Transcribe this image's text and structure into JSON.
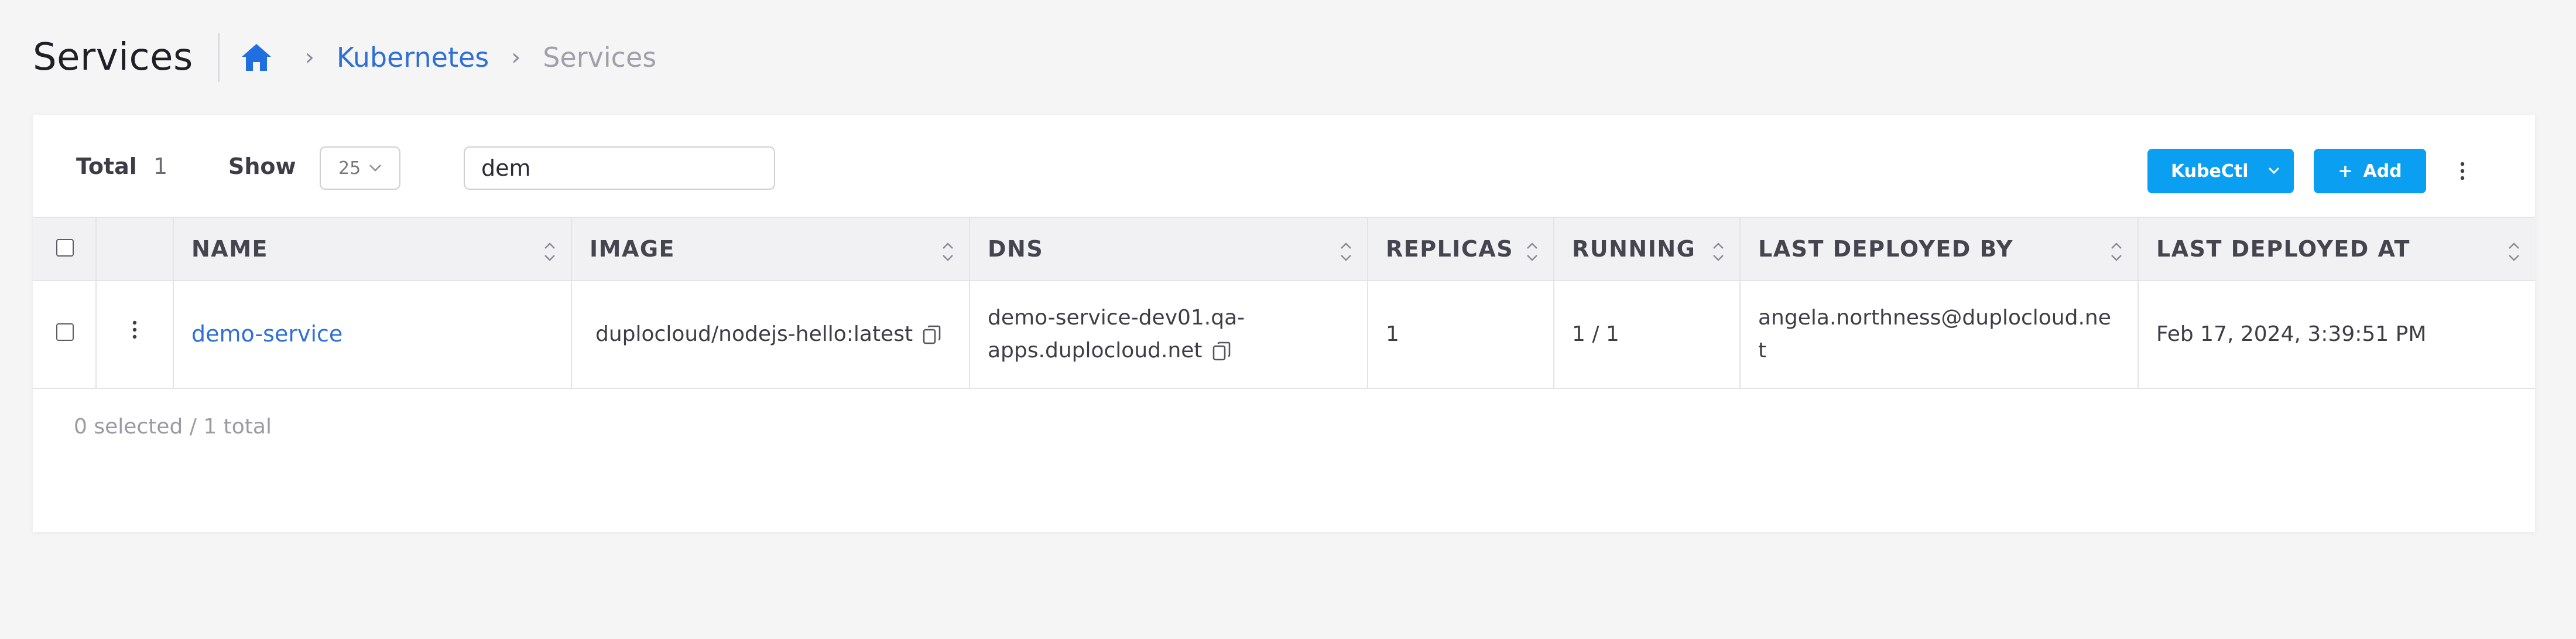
{
  "header": {
    "title": "Services",
    "breadcrumb": {
      "parent": "Kubernetes",
      "current": "Services",
      "separator": "›"
    }
  },
  "toolbar": {
    "total_label": "Total",
    "total_value": "1",
    "show_label": "Show",
    "page_size": "25",
    "search_value": "dem",
    "kubectl_label": "KubeCtl",
    "add_label": "Add",
    "add_icon": "+"
  },
  "table": {
    "columns": [
      "NAME",
      "IMAGE",
      "DNS",
      "REPLICAS",
      "RUNNING",
      "LAST DEPLOYED BY",
      "LAST DEPLOYED AT"
    ],
    "rows": [
      {
        "name": "demo-service",
        "image": "duplocloud/nodejs-hello:latest",
        "dns_line1": "demo-service-dev01.qa-",
        "dns_line2": "apps.duplocloud.net",
        "replicas": "1",
        "running": "1 / 1",
        "deployed_by_line1": "angela.northness@duplocloud.ne",
        "deployed_by_line2": "t",
        "deployed_at": "Feb 17, 2024, 3:39:51 PM"
      }
    ]
  },
  "footer": {
    "selection_text": "0 selected / 1 total"
  },
  "colors": {
    "accent": "#0a9ff0",
    "link": "#2f6fd6",
    "header_bg": "#f1f1f4",
    "page_bg": "#f5f5f6"
  },
  "icons": {
    "home": "home-icon",
    "sort": "sort-icon",
    "copy": "copy-icon",
    "kebab": "kebab-icon",
    "chevron": "chevron-down-icon"
  }
}
